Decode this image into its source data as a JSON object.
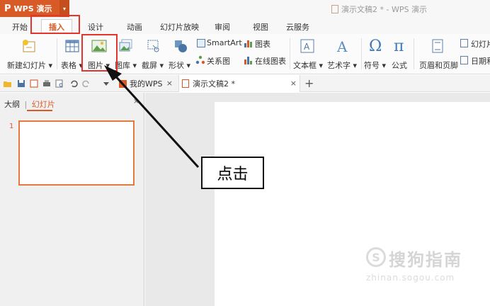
{
  "app": {
    "name": "WPS 演示",
    "logo_glyph": "P",
    "caret": "▾"
  },
  "window": {
    "title": "演示文稿2 * - WPS 演示"
  },
  "tabs": {
    "start": "开始",
    "insert": "插入",
    "design": "设计",
    "animation": "动画",
    "slideshow": "幻灯片放映",
    "review": "审阅",
    "view": "视图",
    "cloud": "云服务"
  },
  "ribbon": {
    "new_slide": "新建幻灯片 ▾",
    "table": "表格 ▾",
    "picture": "图片 ▾",
    "gallery": "图库 ▾",
    "screenshot": "截屏 ▾",
    "shapes": "形状 ▾",
    "smartart": "SmartArt",
    "chart": "图表",
    "relation": "关系图",
    "online_chart": "在线图表",
    "textbox": "文本框 ▾",
    "wordart": "艺术字 ▾",
    "symbol": "符号 ▾",
    "formula": "公式",
    "header_footer": "页眉和页脚",
    "slide_number": "幻灯片",
    "datetime": "日期和"
  },
  "doc_tabs": {
    "mywps": "我的WPS",
    "doc2": "演示文稿2 *",
    "close": "×",
    "add": "+"
  },
  "panel": {
    "outline": "大纲",
    "divider": "|",
    "slides": "幻灯片",
    "close": "×",
    "slide_number": "1"
  },
  "annotation": {
    "text": "点击"
  },
  "watermark": {
    "text": "搜狗指南",
    "url": "zhinan.sogou.com",
    "logo": "S"
  },
  "colors": {
    "accent": "#d85b27",
    "highlight_red": "#e4342c"
  }
}
